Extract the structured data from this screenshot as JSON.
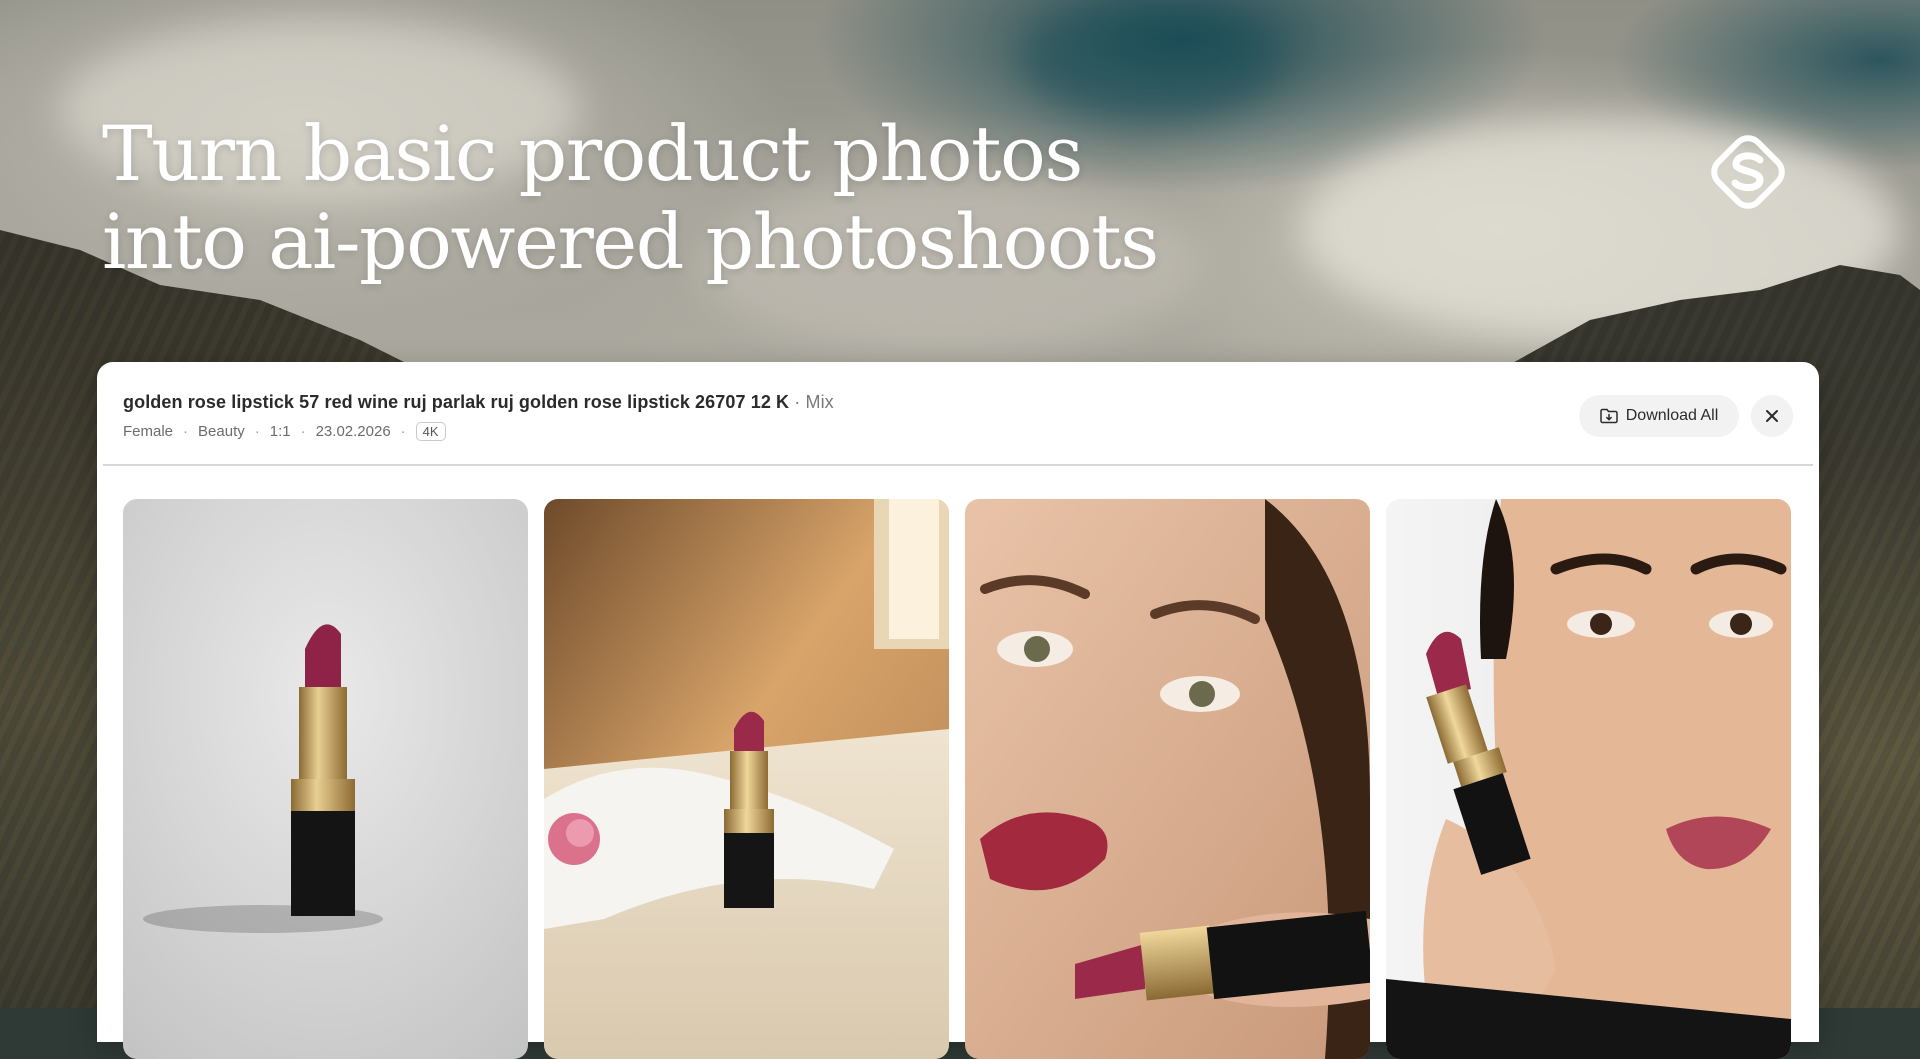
{
  "hero": {
    "title_line1": "Turn basic product photos",
    "title_line2": "into ai-powered photoshoots"
  },
  "brand": {
    "logo_icon": "brand-s-logo-icon"
  },
  "session": {
    "title": "golden rose lipstick 57 red wine ruj parlak ruj golden rose lipstick 26707 12 K",
    "separator": "·",
    "mode": "Mix",
    "meta": {
      "gender": "Female",
      "category": "Beauty",
      "aspect_ratio": "1:1",
      "date": "23.02.2026",
      "resolution": "4K"
    },
    "meta_separator": "·"
  },
  "actions": {
    "download_label": "Download All",
    "download_icon": "folder-download-icon",
    "close_icon": "close-icon"
  },
  "colors": {
    "lipstick": "#9b2a4a",
    "gold": "#c9a25a",
    "case": "#141414"
  }
}
